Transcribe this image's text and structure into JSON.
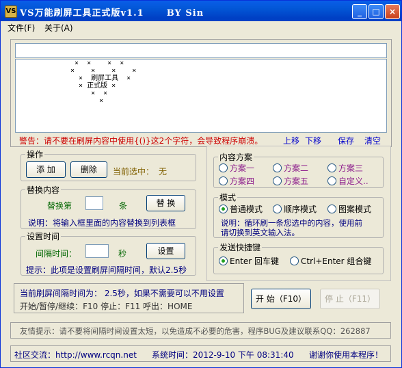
{
  "window": {
    "title": "VS万能刷屏工具正式版v1.1      BY Sin",
    "icon_glyph": "VS"
  },
  "menu": [
    {
      "label": "文件(F)"
    },
    {
      "label": "关于(A)"
    }
  ],
  "art_text": " ×  ×    ×  ×\n×    ×    ×    ×\n  ×  刷屏工具  ×\n  × 正式版 ×\n     ×  ×\n       ×",
  "warning": "警告：请不要在刷屏内容中使用{()}这2个字符，会导致程序崩溃。",
  "links": {
    "up": "上移",
    "down": "下移",
    "save": "保存",
    "clear": "清空"
  },
  "operation": {
    "legend": "操作",
    "add": "添 加",
    "delete": "删除",
    "selected_label": "当前选中：",
    "selected_value": "无"
  },
  "replace": {
    "legend": "替换内容",
    "label1": "替换第",
    "label2": "条",
    "button": "替 换",
    "note": "说明：将输入框里面的内容替换到列表框"
  },
  "interval": {
    "legend": "设置时间",
    "label": "间隔时间：",
    "unit": "秒",
    "button": "设置",
    "note": "提示：此项是设置刷屏间隔时间，默认2.5秒"
  },
  "schemes": {
    "legend": "内容方案",
    "options": [
      "方案一",
      "方案二",
      "方案三",
      "方案四",
      "方案五",
      "自定义.."
    ]
  },
  "mode": {
    "legend": "模式",
    "options": [
      "普通模式",
      "顺序模式",
      "图案模式"
    ],
    "selected": "普通模式",
    "note1": "说明：循环刷一条您选中的内容，使用前",
    "note2": "请切换到英文输入法。"
  },
  "shortcut": {
    "legend": "发送快捷键",
    "options": [
      "Enter 回车键",
      "Ctrl+Enter 组合键"
    ],
    "selected": "Enter 回车键"
  },
  "status": {
    "line1": "当前刷屏间隔时间为： 2.5秒，如果不需要可以不用设置",
    "line2": "开始/暂停/继续：F10     停止：F11     呼出：HOME"
  },
  "controls": {
    "start": "开 始（F10）",
    "stop": "停 止（F11）"
  },
  "tip": "友情提示：请不要将间隔时间设置太短，以免造成不必要的危害，程序BUG及建议联系QQ：262887",
  "footer": {
    "community": "社区交流：http://www.rcqn.net",
    "time": "系统时间：2012-9-10 下午 08:31:40",
    "thanks": "谢谢你使用本程序！"
  },
  "colors": {
    "accent": "#0054e3",
    "warning": "#cc0000",
    "link": "#0000cc"
  }
}
